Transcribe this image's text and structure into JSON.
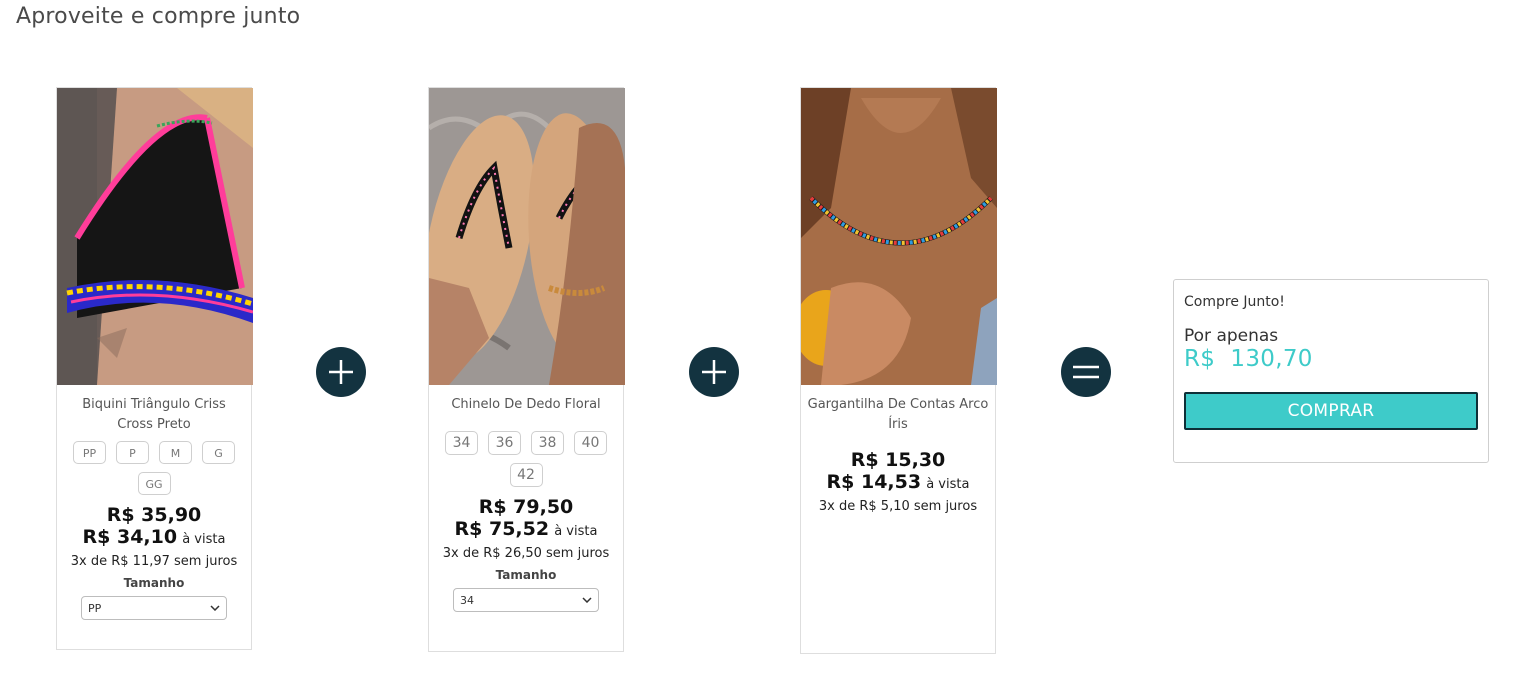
{
  "section": {
    "title": "Aproveite e compre junto"
  },
  "products": [
    {
      "name": "Biquini Triângulo Criss Cross Preto",
      "sizes": [
        "PP",
        "P",
        "M",
        "G",
        "GG"
      ],
      "price": "R$ 35,90",
      "price_vista": "R$ 34,10",
      "vista_label": "à vista",
      "installments": "3x de R$ 11,97 sem juros",
      "size_label": "Tamanho",
      "selected_size": "PP"
    },
    {
      "name": "Chinelo De Dedo Floral",
      "sizes": [
        "34",
        "36",
        "38",
        "40",
        "42"
      ],
      "price": "R$ 79,50",
      "price_vista": "R$ 75,52",
      "vista_label": "à vista",
      "installments": "3x de R$ 26,50 sem juros",
      "size_label": "Tamanho",
      "selected_size": "34"
    },
    {
      "name": "Gargantilha De Contas Arco Íris",
      "price": "R$ 15,30",
      "price_vista": "R$ 14,53",
      "vista_label": "à vista",
      "installments": "3x de R$ 5,10 sem juros"
    }
  ],
  "operators": [
    "plus-icon",
    "plus-icon",
    "equals-icon"
  ],
  "summary": {
    "title": "Compre Junto!",
    "subtitle": "Por apenas",
    "total": "R$  130,70",
    "button_label": "COMPRAR"
  },
  "colors": {
    "accent": "#3ecbc9",
    "dark": "#133340"
  }
}
